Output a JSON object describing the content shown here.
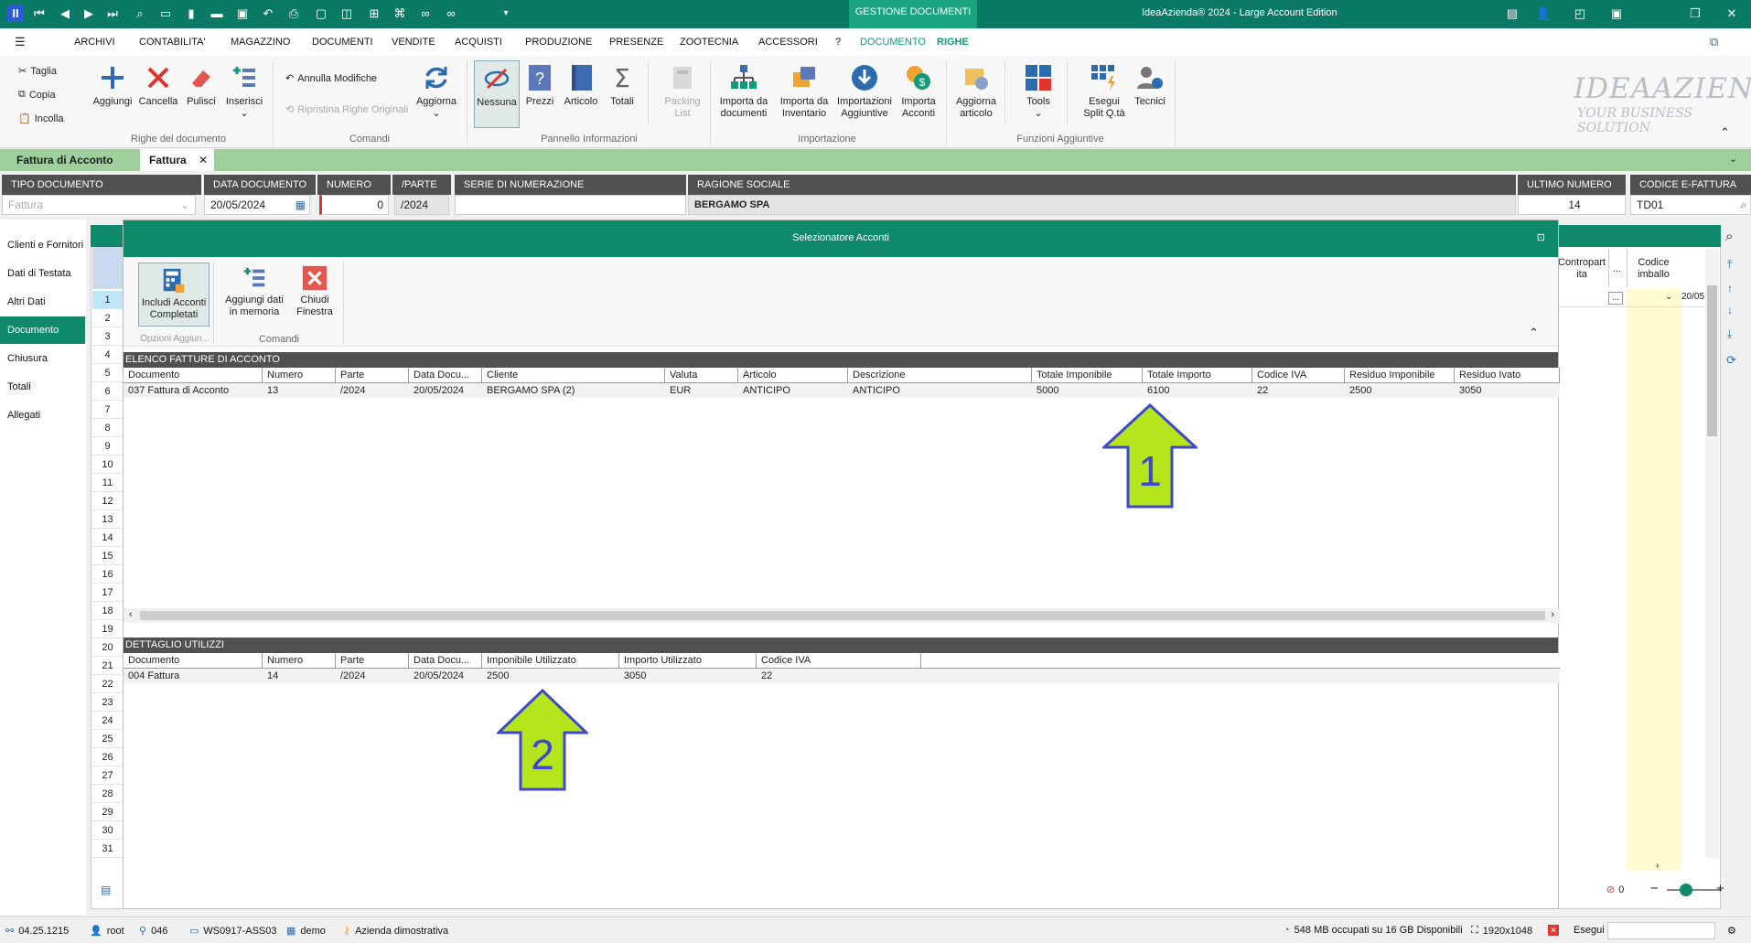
{
  "titlebar": {
    "section_tab": "GESTIONE DOCUMENTI",
    "app_title": "IdeaAzienda® 2024 - Large Account Edition"
  },
  "menu": {
    "items": [
      "ARCHIVI",
      "CONTABILITA'",
      "MAGAZZINO",
      "DOCUMENTI",
      "VENDITE",
      "ACQUISTI",
      "PRODUZIONE",
      "PRESENZE",
      "ZOOTECNIA",
      "ACCESSORI",
      "?",
      "DOCUMENTO",
      "RIGHE"
    ]
  },
  "ribbon": {
    "clipboard": {
      "cut": "Taglia",
      "copy": "Copia",
      "paste": "Incolla"
    },
    "righe": {
      "add": "Aggiungi",
      "delete": "Cancella",
      "clean": "Pulisci",
      "insert": "Inserisci",
      "group": "Righe del documento"
    },
    "comandi": {
      "undo": "Annulla Modifiche",
      "restore": "Ripristina Righe Originali",
      "refresh": "Aggiorna",
      "group": "Comandi"
    },
    "pannello": {
      "none": "Nessuna",
      "prices": "Prezzi",
      "article": "Articolo",
      "totals": "Totali",
      "packing1": "Packing",
      "packing2": "List",
      "group": "Pannello Informazioni"
    },
    "importazione": {
      "imp_doc1": "Importa da",
      "imp_doc2": "documenti",
      "imp_inv1": "Importa da",
      "imp_inv2": "Inventario",
      "imp_add1": "Importazioni",
      "imp_add2": "Aggiuntive",
      "imp_acc1": "Importa",
      "imp_acc2": "Acconti",
      "group": "Importazione"
    },
    "funzioni": {
      "upd_art1": "Aggiorna",
      "upd_art2": "articolo",
      "tools": "Tools",
      "split1": "Esegui",
      "split2": "Split Q.tà",
      "tech": "Tecnici",
      "group": "Funzioni Aggiuntive"
    },
    "logo1": "IDEAAZIENDA",
    "logo2": "YOUR BUSINESS SOLUTION"
  },
  "doc_tabs": [
    "Fattura di Acconto",
    "Fattura"
  ],
  "header": {
    "tipo_label": "TIPO DOCUMENTO",
    "tipo_value": "Fattura",
    "data_label": "DATA DOCUMENTO",
    "data_value": "20/05/2024",
    "numero_label": "NUMERO",
    "numero_value": "0",
    "parte_label": "/PARTE",
    "parte_value": "/2024",
    "serie_label": "SERIE DI NUMERAZIONE",
    "serie_value": "",
    "ragione_label": "RAGIONE SOCIALE",
    "ragione_value": "BERGAMO SPA",
    "ultimo_label": "ULTIMO NUMERO",
    "ultimo_value": "14",
    "codice_label": "CODICE E-FATTURA",
    "codice_value": "TD01"
  },
  "nav": [
    "Clienti e Fornitori",
    "Dati di Testata",
    "Altri Dati",
    "Documento",
    "Chiusura",
    "Totali",
    "Allegati"
  ],
  "grid_right": {
    "col1": "Contropart ita",
    "col2": "...",
    "col3": "Codice imballo",
    "partial_date": "20/05",
    "ellipsis": "..."
  },
  "modal": {
    "title": "Selezionatore Acconti",
    "btn_include1": "Includi Acconti",
    "btn_include2": "Completati",
    "btn_memory1": "Aggiungi dati",
    "btn_memory2": "in memoria",
    "btn_close1": "Chiudi",
    "btn_close2": "Finestra",
    "group_opzioni": "Opzioni Aggiun...",
    "group_comandi": "Comandi",
    "section1": "ELENCO FATTURE DI ACCONTO",
    "section2": "DETTAGLIO UTILIZZI",
    "table1_headers": [
      "Documento",
      "Numero",
      "Parte",
      "Data Docu...",
      "Cliente",
      "Valuta",
      "Articolo",
      "Descrizione",
      "Totale Imponibile",
      "Totale Importo",
      "Codice IVA",
      "Residuo Imponibile",
      "Residuo Ivato"
    ],
    "table1_rows": [
      [
        "037 Fattura di Acconto",
        "13",
        "/2024",
        "20/05/2024",
        "BERGAMO SPA (2)",
        "EUR",
        "ANTICIPO",
        "ANTICIPO",
        "5000",
        "6100",
        "22",
        "2500",
        "3050"
      ]
    ],
    "table2_headers": [
      "Documento",
      "Numero",
      "Parte",
      "Data Docu...",
      "Imponibile Utilizzato",
      "Importo Utilizzato",
      "Codice IVA"
    ],
    "table2_rows": [
      [
        "004 Fattura",
        "14",
        "/2024",
        "20/05/2024",
        "2500",
        "3050",
        "22"
      ]
    ],
    "arrow1": "1",
    "arrow2": "2"
  },
  "zoom": {
    "errors": "0"
  },
  "statusbar": {
    "version": "04.25.1215",
    "user": "root",
    "company_code": "046",
    "workstation": "WS0917-ASS03",
    "db": "demo",
    "company": "Azienda dimostrativa",
    "memory": "548 MB occupati su 16 GB Disponibili",
    "resolution": "1920x1048",
    "exec_label": "Esegui"
  },
  "colors": {
    "primary": "#0e8a6b",
    "tab_strip": "#9fcf9c",
    "arrow_fill": "#b5e61d",
    "arrow_stroke": "#3f48cc"
  }
}
